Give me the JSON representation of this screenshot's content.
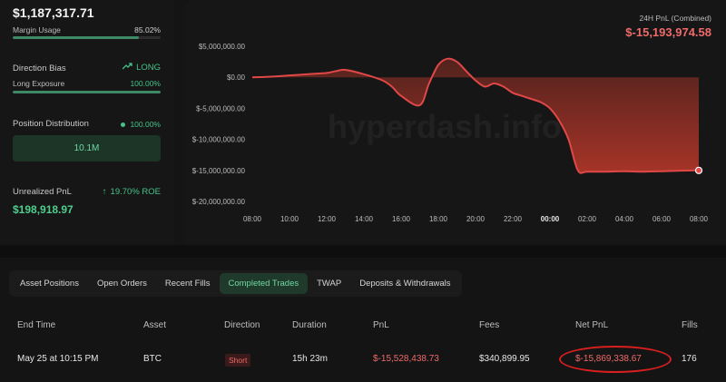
{
  "account": {
    "balance": "$1,187,317.71",
    "margin_usage_label": "Margin Usage",
    "margin_usage_value": "85.02%",
    "margin_usage_fraction": 0.8502
  },
  "direction": {
    "title": "Direction Bias",
    "bias_value": "LONG",
    "long_exposure_label": "Long Exposure",
    "long_exposure_value": "100.00%",
    "long_exposure_fraction": 1.0
  },
  "distribution": {
    "title": "Position Distribution",
    "percent": "100.00%",
    "amount": "10.1M"
  },
  "unrealized": {
    "title": "Unrealized PnL",
    "roe": "19.70% ROE",
    "value": "$198,918.97"
  },
  "chart_header": {
    "title": "24H PnL (Combined)",
    "value": "$-15,193,974.58",
    "watermark": "hyperdash.info"
  },
  "chart_data": {
    "type": "area",
    "title": "24H PnL (Combined)",
    "y_ticks": [
      "$5,000,000.00",
      "$0.00",
      "$-5,000,000.00",
      "$-10,000,000.00",
      "$-15,000,000.00",
      "$-20,000,000.00"
    ],
    "y_tick_values": [
      5000000,
      0,
      -5000000,
      -10000000,
      -15000000,
      -20000000
    ],
    "ylim": [
      -20000000,
      5000000
    ],
    "x_ticks": [
      "08:00",
      "10:00",
      "12:00",
      "14:00",
      "16:00",
      "18:00",
      "20:00",
      "22:00",
      "00:00",
      "02:00",
      "04:00",
      "06:00",
      "08:00"
    ],
    "x_hours": [
      0,
      2,
      4,
      6,
      8,
      10,
      12,
      14,
      16,
      18,
      20,
      22,
      24
    ],
    "series": [
      {
        "color": "#e04848",
        "x": [
          0,
          1,
          2,
          3,
          4,
          4.5,
          5,
          6,
          7,
          7.5,
          8,
          9,
          9.5,
          10,
          10.5,
          11,
          11.5,
          12,
          12.5,
          13,
          13.5,
          14,
          14.5,
          15,
          15.5,
          16,
          16.5,
          17,
          17.5,
          18,
          19,
          20,
          21,
          22,
          23,
          24
        ],
        "y": [
          0,
          100000,
          300000,
          500000,
          700000,
          1000000,
          1200000,
          500000,
          -500000,
          -1500000,
          -3000000,
          -4500000,
          -1000000,
          2000000,
          3000000,
          2500000,
          1000000,
          -500000,
          -1500000,
          -1000000,
          -1500000,
          -2500000,
          -3000000,
          -3500000,
          -4000000,
          -5000000,
          -7000000,
          -10000000,
          -15000000,
          -15200000,
          -15200000,
          -15150000,
          -15200000,
          -15150000,
          -15050000,
          -15000000
        ]
      }
    ]
  },
  "tabs": [
    "Asset Positions",
    "Open Orders",
    "Recent Fills",
    "Completed Trades",
    "TWAP",
    "Deposits & Withdrawals"
  ],
  "active_tab": "Completed Trades",
  "table": {
    "headers": [
      "End Time",
      "Asset",
      "Direction",
      "Duration",
      "PnL",
      "Fees",
      "Net PnL",
      "Fills"
    ],
    "rows": [
      {
        "end_time": "May 25 at 10:15 PM",
        "asset": "BTC",
        "direction": "Short",
        "duration": "15h 23m",
        "pnl": "$-15,528,438.73",
        "fees": "$340,899.95",
        "net_pnl": "$-15,869,338.67",
        "fills": "176"
      }
    ]
  },
  "colors": {
    "accent_green": "#46c28a",
    "loss_red": "#ef6a6a",
    "highlight_oval": "#d81f1f"
  }
}
